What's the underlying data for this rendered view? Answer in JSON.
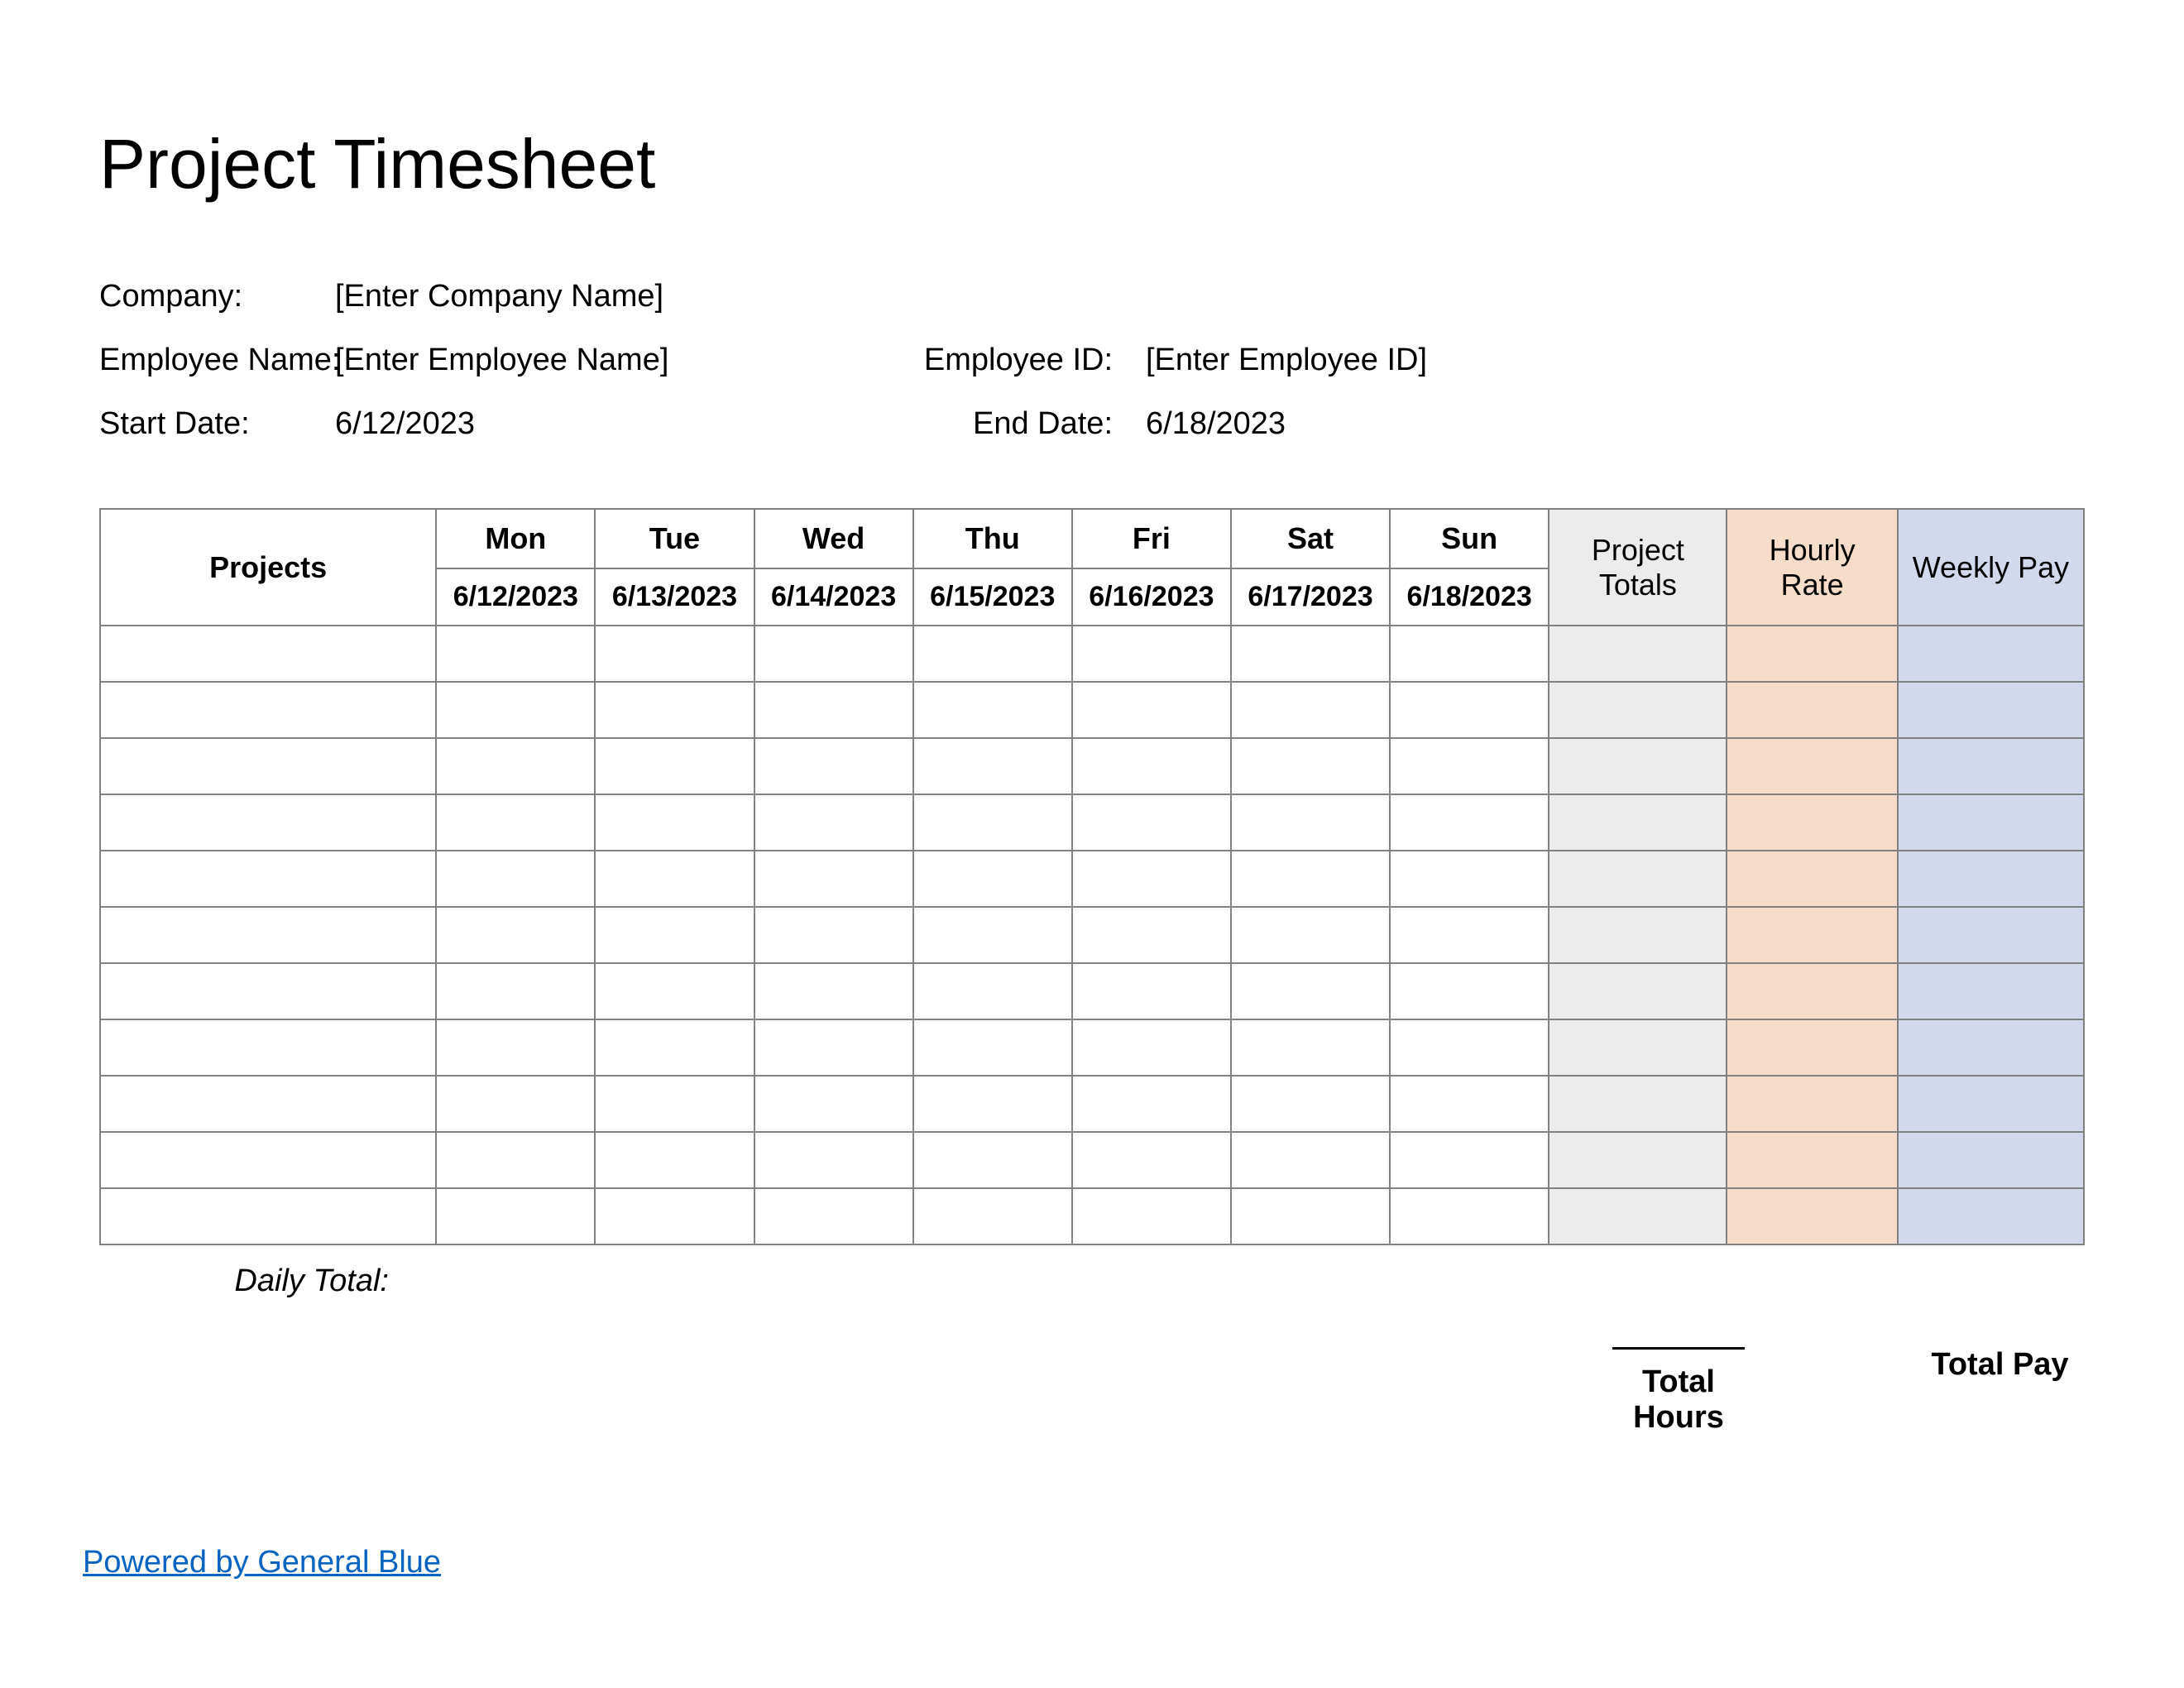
{
  "title": "Project Timesheet",
  "info": {
    "company_label": "Company:",
    "company_value": "[Enter Company Name]",
    "employee_label": "Employee Name:",
    "employee_value": "[Enter Employee Name]",
    "employee_id_label": "Employee ID:",
    "employee_id_value": "[Enter Employee ID]",
    "start_label": "Start Date:",
    "start_value": "6/12/2023",
    "end_label": "End Date:",
    "end_value": "6/18/2023"
  },
  "headers": {
    "projects": "Projects",
    "days": [
      "Mon",
      "Tue",
      "Wed",
      "Thu",
      "Fri",
      "Sat",
      "Sun"
    ],
    "dates": [
      "6/12/2023",
      "6/13/2023",
      "6/14/2023",
      "6/15/2023",
      "6/16/2023",
      "6/17/2023",
      "6/18/2023"
    ],
    "project_totals": "Project Totals",
    "hourly_rate": "Hourly Rate",
    "weekly_pay": "Weekly Pay"
  },
  "rows": 11,
  "footer": {
    "daily_total": "Daily Total:",
    "total_hours": "Total Hours",
    "total_pay": "Total Pay",
    "powered_by": "Powered by General Blue"
  },
  "colors": {
    "grey": "#ececec",
    "orange": "#f7ddc9",
    "blue": "#d3d9ec"
  }
}
